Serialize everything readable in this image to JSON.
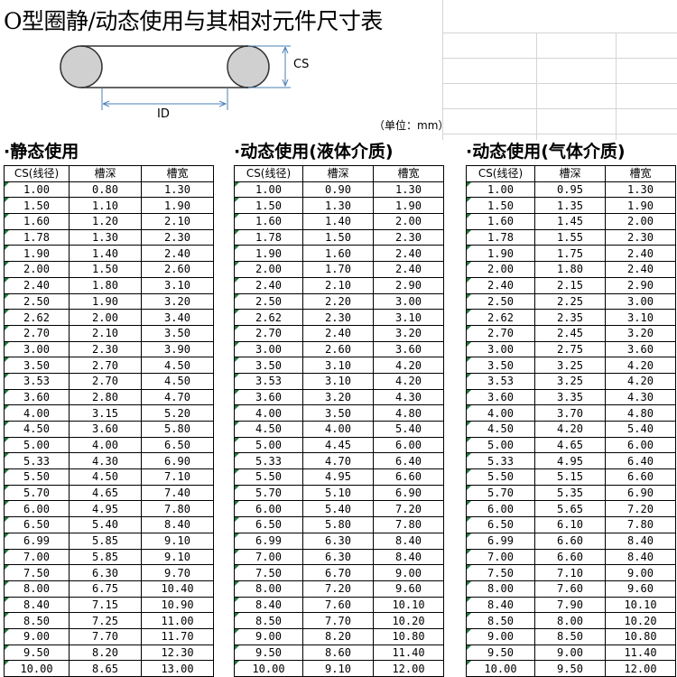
{
  "title": "O型圈静/动态使用与其相对元件尺寸表",
  "unit_note": "（单位：mm）",
  "diagram": {
    "cs_label": "CS",
    "id_label": "ID"
  },
  "columns": [
    "CS(线径)",
    "槽深",
    "槽宽"
  ],
  "sections": [
    {
      "title": "·静态使用",
      "rows": [
        [
          "1.00",
          "0.80",
          "1.30"
        ],
        [
          "1.50",
          "1.10",
          "1.90"
        ],
        [
          "1.60",
          "1.20",
          "2.10"
        ],
        [
          "1.78",
          "1.30",
          "2.30"
        ],
        [
          "1.90",
          "1.40",
          "2.40"
        ],
        [
          "2.00",
          "1.50",
          "2.60"
        ],
        [
          "2.40",
          "1.80",
          "3.10"
        ],
        [
          "2.50",
          "1.90",
          "3.20"
        ],
        [
          "2.62",
          "2.00",
          "3.40"
        ],
        [
          "2.70",
          "2.10",
          "3.50"
        ],
        [
          "3.00",
          "2.30",
          "3.90"
        ],
        [
          "3.50",
          "2.70",
          "4.50"
        ],
        [
          "3.53",
          "2.70",
          "4.50"
        ],
        [
          "3.60",
          "2.80",
          "4.70"
        ],
        [
          "4.00",
          "3.15",
          "5.20"
        ],
        [
          "4.50",
          "3.60",
          "5.80"
        ],
        [
          "5.00",
          "4.00",
          "6.50"
        ],
        [
          "5.33",
          "4.30",
          "6.90"
        ],
        [
          "5.50",
          "4.50",
          "7.10"
        ],
        [
          "5.70",
          "4.65",
          "7.40"
        ],
        [
          "6.00",
          "4.95",
          "7.80"
        ],
        [
          "6.50",
          "5.40",
          "8.40"
        ],
        [
          "6.99",
          "5.85",
          "9.10"
        ],
        [
          "7.00",
          "5.85",
          "9.10"
        ],
        [
          "7.50",
          "6.30",
          "9.70"
        ],
        [
          "8.00",
          "6.75",
          "10.40"
        ],
        [
          "8.40",
          "7.15",
          "10.90"
        ],
        [
          "8.50",
          "7.25",
          "11.00"
        ],
        [
          "9.00",
          "7.70",
          "11.70"
        ],
        [
          "9.50",
          "8.20",
          "12.30"
        ],
        [
          "10.00",
          "8.65",
          "13.00"
        ]
      ]
    },
    {
      "title": "·动态使用(液体介质)",
      "rows": [
        [
          "1.00",
          "0.90",
          "1.30"
        ],
        [
          "1.50",
          "1.30",
          "1.90"
        ],
        [
          "1.60",
          "1.40",
          "2.00"
        ],
        [
          "1.78",
          "1.50",
          "2.30"
        ],
        [
          "1.90",
          "1.60",
          "2.40"
        ],
        [
          "2.00",
          "1.70",
          "2.40"
        ],
        [
          "2.40",
          "2.10",
          "2.90"
        ],
        [
          "2.50",
          "2.20",
          "3.00"
        ],
        [
          "2.62",
          "2.30",
          "3.10"
        ],
        [
          "2.70",
          "2.40",
          "3.20"
        ],
        [
          "3.00",
          "2.60",
          "3.60"
        ],
        [
          "3.50",
          "3.10",
          "4.20"
        ],
        [
          "3.53",
          "3.10",
          "4.20"
        ],
        [
          "3.60",
          "3.20",
          "4.30"
        ],
        [
          "4.00",
          "3.50",
          "4.80"
        ],
        [
          "4.50",
          "4.00",
          "5.40"
        ],
        [
          "5.00",
          "4.45",
          "6.00"
        ],
        [
          "5.33",
          "4.70",
          "6.40"
        ],
        [
          "5.50",
          "4.95",
          "6.60"
        ],
        [
          "5.70",
          "5.10",
          "6.90"
        ],
        [
          "6.00",
          "5.40",
          "7.20"
        ],
        [
          "6.50",
          "5.80",
          "7.80"
        ],
        [
          "6.99",
          "6.30",
          "8.40"
        ],
        [
          "7.00",
          "6.30",
          "8.40"
        ],
        [
          "7.50",
          "6.70",
          "9.00"
        ],
        [
          "8.00",
          "7.20",
          "9.60"
        ],
        [
          "8.40",
          "7.60",
          "10.10"
        ],
        [
          "8.50",
          "7.70",
          "10.20"
        ],
        [
          "9.00",
          "8.20",
          "10.80"
        ],
        [
          "9.50",
          "8.60",
          "11.40"
        ],
        [
          "10.00",
          "9.10",
          "12.00"
        ]
      ]
    },
    {
      "title": "·动态使用(气体介质)",
      "rows": [
        [
          "1.00",
          "0.95",
          "1.30"
        ],
        [
          "1.50",
          "1.35",
          "1.90"
        ],
        [
          "1.60",
          "1.45",
          "2.00"
        ],
        [
          "1.78",
          "1.55",
          "2.30"
        ],
        [
          "1.90",
          "1.75",
          "2.40"
        ],
        [
          "2.00",
          "1.80",
          "2.40"
        ],
        [
          "2.40",
          "2.15",
          "2.90"
        ],
        [
          "2.50",
          "2.25",
          "3.00"
        ],
        [
          "2.62",
          "2.35",
          "3.10"
        ],
        [
          "2.70",
          "2.45",
          "3.20"
        ],
        [
          "3.00",
          "2.75",
          "3.60"
        ],
        [
          "3.50",
          "3.25",
          "4.20"
        ],
        [
          "3.53",
          "3.25",
          "4.20"
        ],
        [
          "3.60",
          "3.35",
          "4.30"
        ],
        [
          "4.00",
          "3.70",
          "4.80"
        ],
        [
          "4.50",
          "4.20",
          "5.40"
        ],
        [
          "5.00",
          "4.65",
          "6.00"
        ],
        [
          "5.33",
          "4.95",
          "6.40"
        ],
        [
          "5.50",
          "5.15",
          "6.60"
        ],
        [
          "5.70",
          "5.35",
          "6.90"
        ],
        [
          "6.00",
          "5.65",
          "7.20"
        ],
        [
          "6.50",
          "6.10",
          "7.80"
        ],
        [
          "6.99",
          "6.60",
          "8.40"
        ],
        [
          "7.00",
          "6.60",
          "8.40"
        ],
        [
          "7.50",
          "7.10",
          "9.00"
        ],
        [
          "8.00",
          "7.60",
          "9.60"
        ],
        [
          "8.40",
          "7.90",
          "10.10"
        ],
        [
          "8.50",
          "8.00",
          "10.20"
        ],
        [
          "9.00",
          "8.50",
          "10.80"
        ],
        [
          "9.50",
          "9.00",
          "11.40"
        ],
        [
          "10.00",
          "9.50",
          "12.00"
        ]
      ]
    }
  ]
}
